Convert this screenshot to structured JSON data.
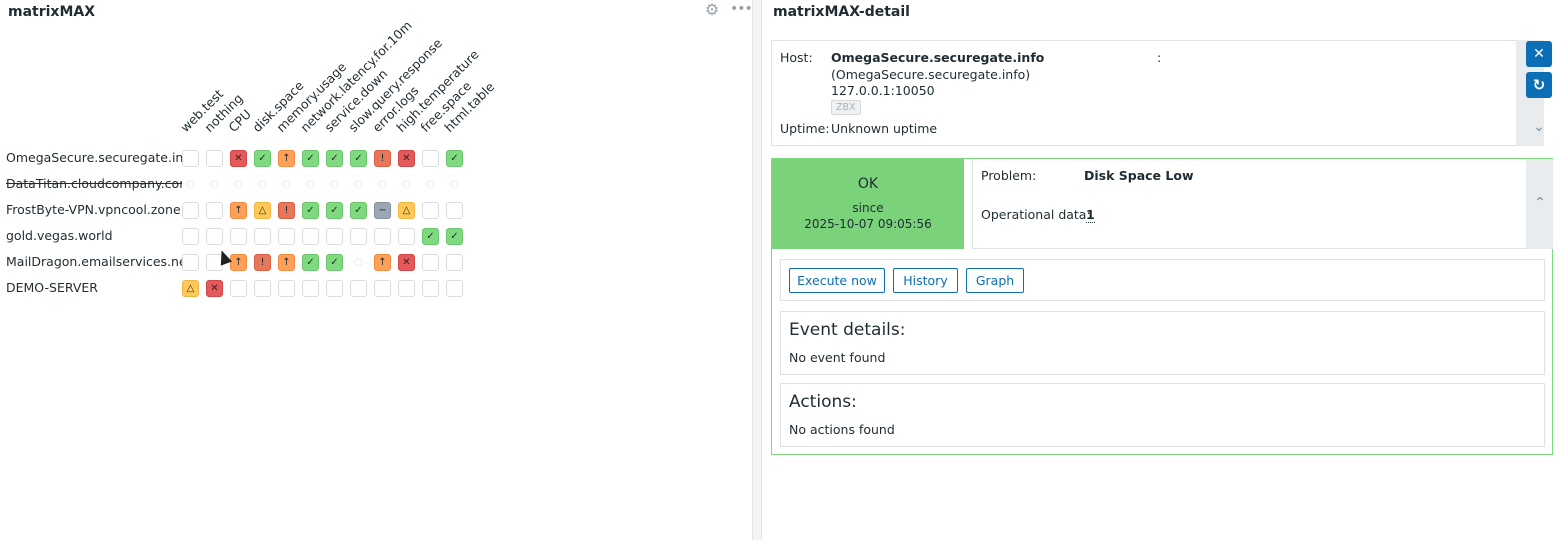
{
  "matrix": {
    "title": "matrixMAX",
    "columns": [
      "web.test",
      "nothing",
      "CPU",
      "disk.space",
      "memory.usage",
      "network.latency.for.10m",
      "service.down",
      "slow.query.response",
      "error.logs",
      "high.temperature",
      "free.space",
      "html.table"
    ],
    "hosts": [
      {
        "name": "OmegaSecure.securegate.info",
        "disabled": false,
        "cells": [
          "empty",
          "empty",
          "err",
          "ok",
          "avg",
          "ok",
          "ok",
          "ok",
          "high",
          "err",
          "empty",
          "ok"
        ]
      },
      {
        "name": "DataTitan.cloudcompany.com",
        "disabled": true,
        "cells": [
          "hidden",
          "hidden",
          "hidden",
          "hidden",
          "hidden",
          "hidden",
          "hidden",
          "hidden",
          "hidden",
          "hidden",
          "hidden",
          "hidden"
        ]
      },
      {
        "name": "FrostByte-VPN.vpncool.zone",
        "disabled": false,
        "cells": [
          "empty",
          "empty",
          "avg",
          "warn",
          "high",
          "ok",
          "ok",
          "ok",
          "info",
          "warn",
          "empty",
          "empty"
        ]
      },
      {
        "name": "gold.vegas.world",
        "disabled": false,
        "cells": [
          "empty",
          "empty",
          "empty",
          "empty",
          "empty",
          "empty",
          "empty",
          "empty",
          "empty",
          "empty",
          "ok",
          "ok"
        ]
      },
      {
        "name": "MailDragon.emailservices.net",
        "disabled": false,
        "cells": [
          "empty",
          "empty",
          "avg",
          "high",
          "avg",
          "ok",
          "ok",
          "hidden",
          "avg",
          "err",
          "empty",
          "empty"
        ]
      },
      {
        "name": "DEMO-SERVER",
        "disabled": false,
        "cells": [
          "warn",
          "err",
          "empty",
          "empty",
          "empty",
          "empty",
          "empty",
          "empty",
          "empty",
          "empty",
          "empty",
          "empty"
        ]
      }
    ],
    "glyphs": {
      "ok": "✓",
      "err": "✕",
      "avg": "↑",
      "high": "!",
      "warn": "△",
      "info": "−",
      "hidden": "◌",
      "empty": ""
    },
    "icons": {
      "settings": "gear-icon",
      "menu": "more-icon"
    }
  },
  "detail": {
    "title": "matrixMAX-detail",
    "host_label": "Host:",
    "host_name": "OmegaSecure.securegate.info",
    "host_colon": ":",
    "host_visible": "(OmegaSecure.securegate.info)",
    "host_address": "127.0.0.1:10050",
    "host_badge": "ZBX",
    "uptime_label": "Uptime:",
    "uptime_value": "Unknown uptime",
    "status": "OK",
    "since_label": "since",
    "since_date": "2025-10-07 09:05:56",
    "problem_label": "Problem:",
    "problem_value": "Disk Space Low",
    "opdata_label": "Operational data:",
    "opdata_value": "1",
    "buttons": {
      "execute": "Execute now",
      "history": "History",
      "graph": "Graph"
    },
    "event_title": "Event details:",
    "event_text": "No event found",
    "actions_title": "Actions:",
    "actions_text": "No actions found",
    "ok_color": "#7ad27a",
    "accent_color": "#0c6fb5"
  }
}
